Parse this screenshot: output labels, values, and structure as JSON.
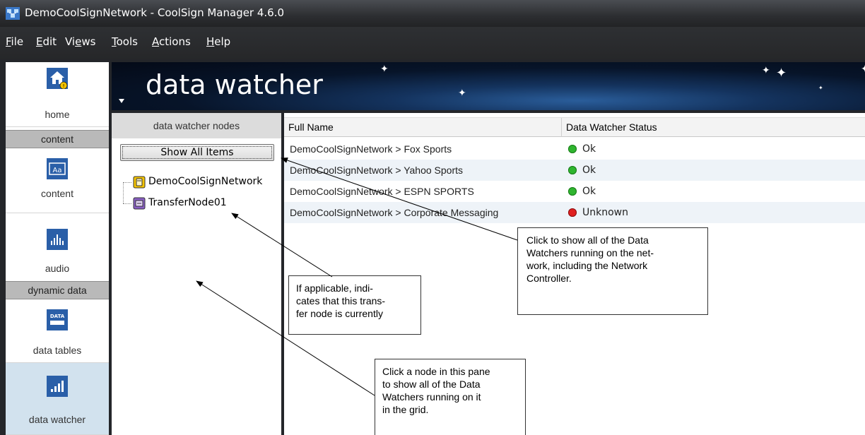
{
  "window": {
    "title": "DemoCoolSignNetwork - CoolSign Manager 4.6.0"
  },
  "menu": [
    {
      "label": "File",
      "accel": "F",
      "rest": "ile"
    },
    {
      "label": "Edit",
      "accel": "E",
      "rest": "dit"
    },
    {
      "label": "Views",
      "pre": "Vi",
      "accel": "e",
      "rest": "ws"
    },
    {
      "label": "Tools",
      "accel": "T",
      "rest": "ools"
    },
    {
      "label": "Actions",
      "accel": "A",
      "rest": "ctions"
    },
    {
      "label": "Help",
      "accel": "H",
      "rest": "elp"
    }
  ],
  "nav": {
    "home_label": "home",
    "section_content": "content",
    "content_label": "content",
    "audio_label": "audio",
    "section_dynamic": "dynamic data",
    "data_tables_label": "data tables",
    "data_tables_icon_text": "DATA",
    "data_watcher_label": "data watcher",
    "content_icon_text": "Aa",
    "selected": "data watcher"
  },
  "banner": {
    "title": "data watcher"
  },
  "nodes_pane": {
    "header": "data watcher nodes",
    "show_all_button": "Show All Items",
    "nodes": [
      {
        "label": "DemoCoolSignNetwork",
        "icon": "network-icon"
      },
      {
        "label": "TransferNode01",
        "icon": "transfer-node-icon"
      }
    ]
  },
  "grid": {
    "columns": [
      "Full Name",
      "Data Watcher Status"
    ],
    "rows": [
      {
        "name": "DemoCoolSignNetwork > Fox Sports",
        "status": "Ok",
        "status_color": "#2fb52f"
      },
      {
        "name": "DemoCoolSignNetwork > Yahoo Sports",
        "status": "Ok",
        "status_color": "#2fb52f"
      },
      {
        "name": "DemoCoolSignNetwork > ESPN SPORTS",
        "status": "Ok",
        "status_color": "#2fb52f"
      },
      {
        "name": "DemoCoolSignNetwork > Corporate Messaging",
        "status": "Unknown",
        "status_color": "#e02020"
      }
    ]
  },
  "callouts": {
    "show_all": [
      "Click to show all of the Data",
      "Watchers running on the net-",
      "work, including the Network",
      "Controller."
    ],
    "transfer": [
      "If applicable, indi-",
      "cates that this trans-",
      "fer node is currently"
    ],
    "pane": [
      "Click a node in this pane",
      "to show all of the Data",
      "Watchers running on it",
      "in the grid."
    ]
  },
  "colors": {
    "ok": "#2fb52f",
    "unknown": "#e02020",
    "nav_selected": "#d2e2ee",
    "chrome": "#2c2e31"
  }
}
